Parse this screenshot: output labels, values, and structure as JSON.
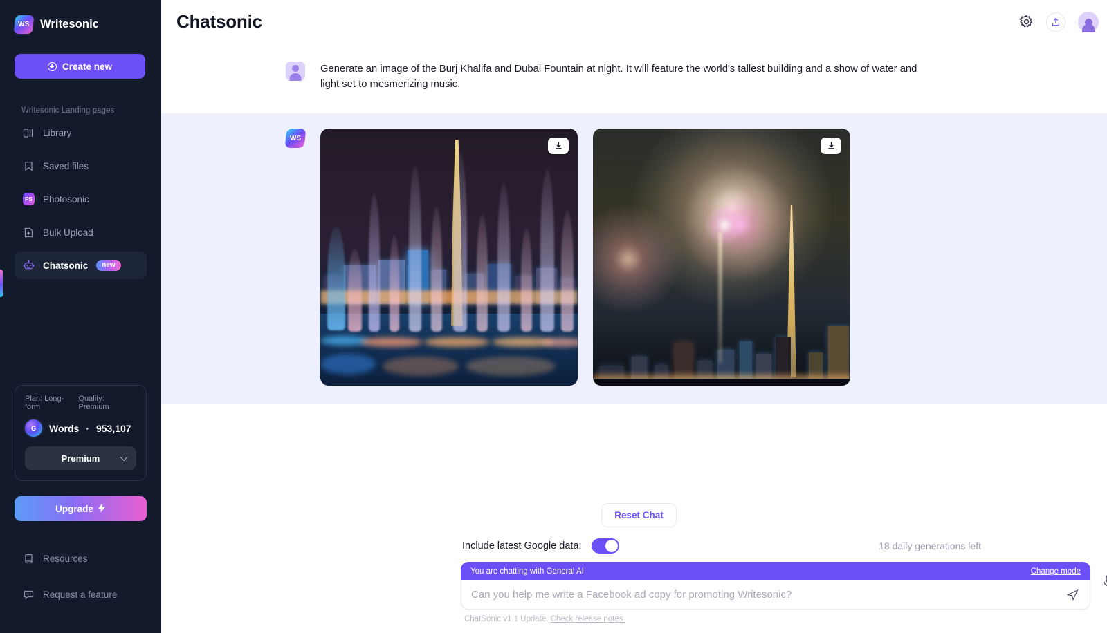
{
  "brand": {
    "name": "Writesonic",
    "logo_text": "WS"
  },
  "sidebar": {
    "create_new_label": "Create new",
    "section_label": "Writesonic Landing pages",
    "items": [
      {
        "label": "Library",
        "icon": "library-icon",
        "active": false
      },
      {
        "label": "Saved files",
        "icon": "bookmark-icon",
        "active": false
      },
      {
        "label": "Photosonic",
        "icon": "photosonic-icon",
        "badge": "PS",
        "active": false
      },
      {
        "label": "Bulk Upload",
        "icon": "bulk-upload-icon",
        "active": false
      },
      {
        "label": "Chatsonic",
        "icon": "robot-icon",
        "badge": "new",
        "active": true
      }
    ],
    "plan_card": {
      "plan_label": "Plan: Long-form",
      "quality_label": "Quality: Premium",
      "words_label": "Words",
      "words_separator": "·",
      "words_count": "953,107",
      "quality_select_value": "Premium"
    },
    "upgrade_label": "Upgrade",
    "upgrade_icon": "bolt-icon",
    "bottom_items": [
      {
        "label": "Resources",
        "icon": "book-icon"
      },
      {
        "label": "Request a feature",
        "icon": "chat-bubble-icon"
      }
    ]
  },
  "topbar": {
    "title": "Chatsonic",
    "settings_icon": "gear-icon",
    "share_icon": "share-upload-icon",
    "avatar_icon": "user-avatar"
  },
  "conversation": {
    "user_message": "Generate an image of the Burj Khalifa and Dubai Fountain at night. It will feature the world's tallest building and a show of water and light set to mesmerizing music.",
    "bot_logo_text": "WS",
    "images": [
      {
        "alt": "Dubai Fountain light show in front of Burj Khalifa at night",
        "download_icon": "download-icon"
      },
      {
        "alt": "Fireworks exploding over the Burj Khalifa and Dubai skyline",
        "download_icon": "download-icon"
      }
    ]
  },
  "footer": {
    "reset_label": "Reset Chat",
    "google_data_label": "Include latest Google data:",
    "google_toggle_state": "on",
    "generations_left": "18 daily generations left",
    "mode_banner": "You are chatting with General AI",
    "change_mode_label": "Change mode",
    "input_placeholder": "Can you help me write a Facebook ad copy for promoting Writesonic?",
    "input_value": "",
    "send_icon": "send-icon",
    "mic_icon": "microphone-icon",
    "release_prefix": "ChatSonic v1.1 Update.",
    "release_link": "Check release notes."
  },
  "colors": {
    "sidebar_bg": "#131a2b",
    "accent_purple": "#6c4ff6",
    "bot_message_bg": "#eef1fd",
    "active_nav_bg": "#1d2538"
  }
}
